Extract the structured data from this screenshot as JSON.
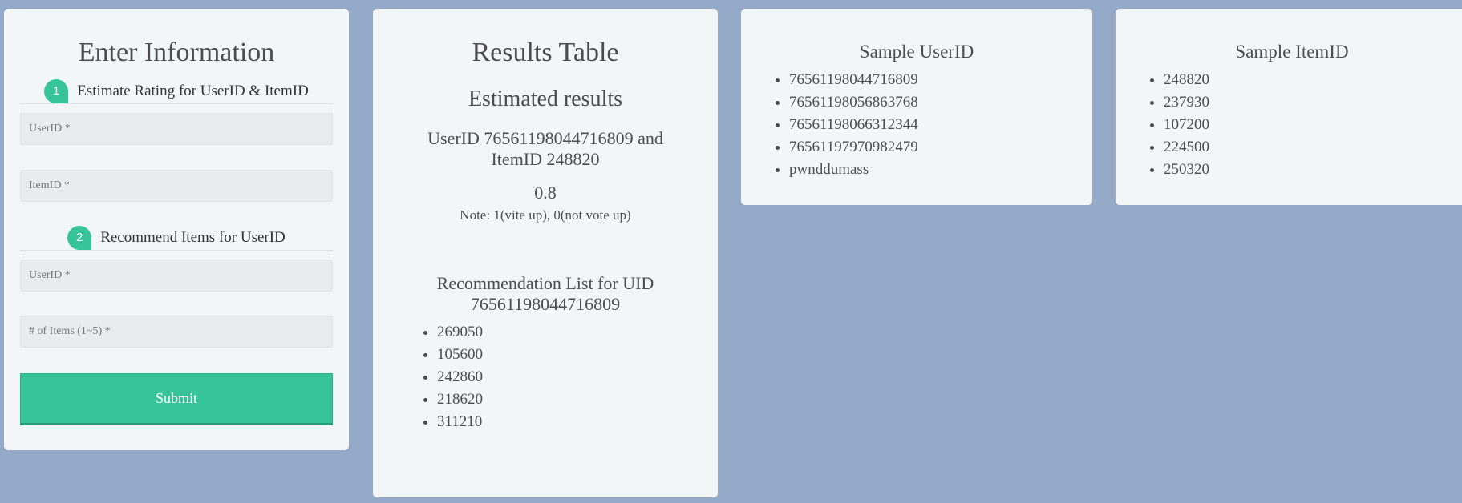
{
  "form": {
    "title": "Enter Information",
    "section1": {
      "number": "1",
      "label": "Estimate Rating for UserID & ItemID",
      "userid_placeholder": "UserID *",
      "itemid_placeholder": "ItemID *"
    },
    "section2": {
      "number": "2",
      "label": "Recommend Items for UserID",
      "userid_placeholder": "UserID *",
      "items_placeholder": "# of Items (1~5) *"
    },
    "submit_label": "Submit",
    "accent_color": "#38c49b"
  },
  "results": {
    "title": "Results Table",
    "estimated_title": "Estimated results",
    "query_text": "UserID 76561198044716809 and ItemID 248820",
    "score": "0.8",
    "note": "Note: 1(vite up), 0(not vote up)",
    "rec_title": "Recommendation List for UID 76561198044716809",
    "rec_items": [
      "269050",
      "105600",
      "242860",
      "218620",
      "311210"
    ]
  },
  "sample_userids": {
    "title": "Sample UserID",
    "items": [
      "76561198044716809",
      "76561198056863768",
      "76561198066312344",
      "76561197970982479",
      "pwnddumass"
    ]
  },
  "sample_itemids": {
    "title": "Sample ItemID",
    "items": [
      "248820",
      "237930",
      "107200",
      "224500",
      "250320"
    ]
  },
  "colors": {
    "background": "#95a9c8",
    "card": "#f3f6f7"
  }
}
